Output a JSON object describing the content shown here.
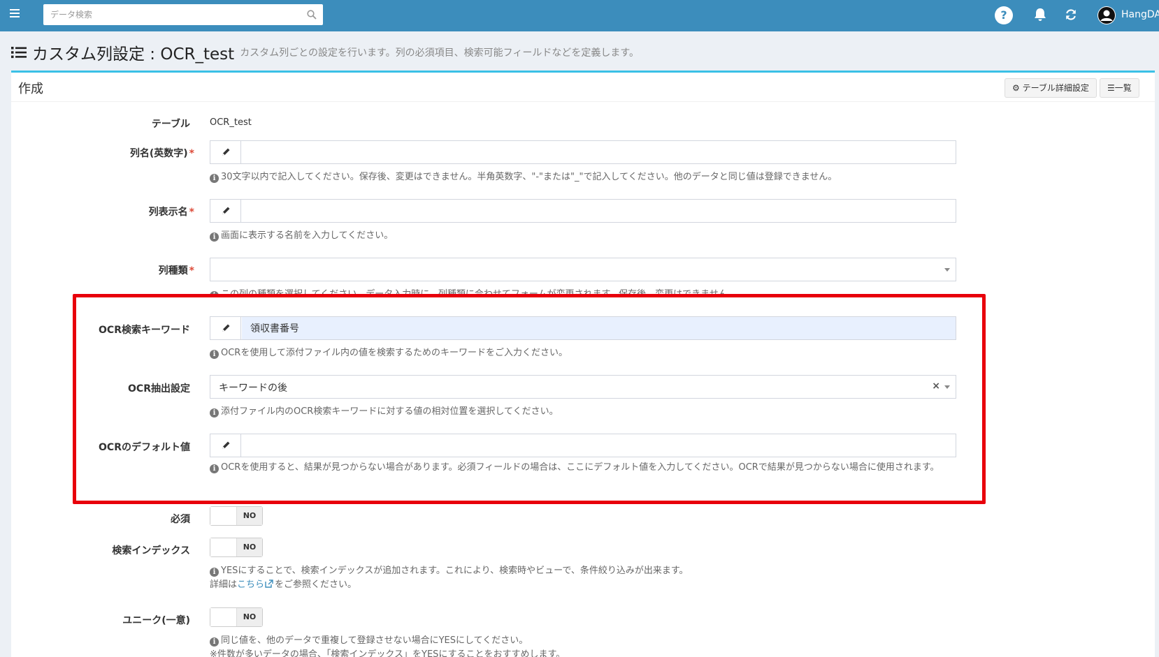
{
  "topbar": {
    "search_placeholder": "データ検索",
    "user_name": "HangDA",
    "help_label": "?"
  },
  "page": {
    "title": "カスタム列設定 : OCR_test",
    "subtitle": "カスタム列ごとの設定を行います。列の必須項目、検索可能フィールドなどを定義します。"
  },
  "box": {
    "title": "作成",
    "table_settings_button": "テーブル詳細設定",
    "list_button": "一覧"
  },
  "form": {
    "table": {
      "label": "テーブル",
      "value": "OCR_test"
    },
    "column_name": {
      "label": "列名(英数字)",
      "required_mark": "*",
      "value": "",
      "help": "30文字以内で記入してください。保存後、変更はできません。半角英数字、\"-\"または\"_\"で記入してください。他のデータと同じ値は登録できません。"
    },
    "display_name": {
      "label": "列表示名",
      "required_mark": "*",
      "value": "",
      "help": "画面に表示する名前を入力してください。"
    },
    "column_type": {
      "label": "列種類",
      "required_mark": "*",
      "value": "",
      "help": "この列の種類を選択してください。データ入力時に、列種類に合わせてフォームが変更されます。保存後、変更はできません。"
    },
    "ocr_keyword": {
      "label": "OCR検索キーワード",
      "value": "領収書番号",
      "help": "OCRを使用して添付ファイル内の値を検索するためのキーワードをご入力ください。"
    },
    "ocr_extract": {
      "label": "OCR抽出設定",
      "value": "キーワードの後",
      "clear": "×",
      "help": "添付ファイル内のOCR検索キーワードに対する値の相対位置を選択してください。"
    },
    "ocr_default": {
      "label": "OCRのデフォルト値",
      "value": "",
      "help": "OCRを使用すると、結果が見つからない場合があります。必須フィールドの場合は、ここにデフォルト値を入力してください。OCRで結果が見つからない場合に使用されます。"
    },
    "required": {
      "label": "必須",
      "state": "NO"
    },
    "search_index": {
      "label": "検索インデックス",
      "state": "NO",
      "help": "YESにすることで、検索インデックスが追加されます。これにより、検索時やビューで、条件絞り込みが出来ます。",
      "help2_before": "詳細は",
      "help2_link": "こちら",
      "help2_after": "をご参照ください。"
    },
    "unique": {
      "label": "ユニーク(一意)",
      "state": "NO",
      "help": "同じ値を、他のデータで重複して登録させない場合にYESにしてください。",
      "help2": "※件数が多いデータの場合、「検索インデックス」をYESにすることをおすすめします。"
    }
  },
  "colors": {
    "topbar": "#3c8dbc",
    "box_border": "#3ac0e6",
    "required": "#dd4b39",
    "highlight": "#e8000b"
  }
}
